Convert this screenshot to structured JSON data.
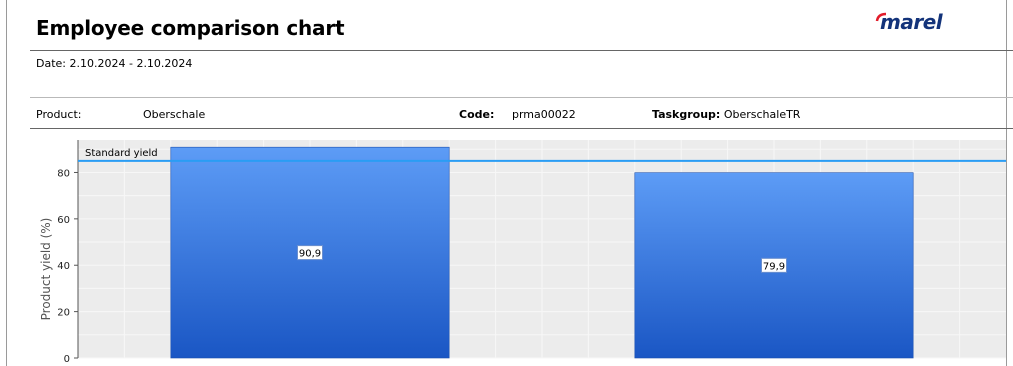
{
  "report": {
    "title": "Employee comparison chart",
    "logo_text": "marel",
    "date_line": "Date: 2.10.2024 - 2.10.2024"
  },
  "info": {
    "product_label": "Product:",
    "product_value": "Oberschale",
    "code_label": "Code:",
    "code_value": "prma00022",
    "taskgroup_label": "Taskgroup:",
    "taskgroup_value": "OberschaleTR"
  },
  "colors": {
    "bar_top": "#5d9cf6",
    "bar_bottom": "#1a56c4",
    "standard_line": "#2a9df4",
    "plot_bg": "#ececec",
    "logo": "#13337a"
  },
  "chart_data": {
    "type": "bar",
    "ylabel": "Product yield (%)",
    "yticks": [
      0,
      20,
      40,
      60,
      80
    ],
    "ylim": [
      0,
      94
    ],
    "grid": true,
    "values": [
      90.9,
      79.9
    ],
    "value_labels": [
      "90,9",
      "79,9"
    ],
    "reference_line": {
      "label": "Standard yield",
      "value": 85
    }
  }
}
